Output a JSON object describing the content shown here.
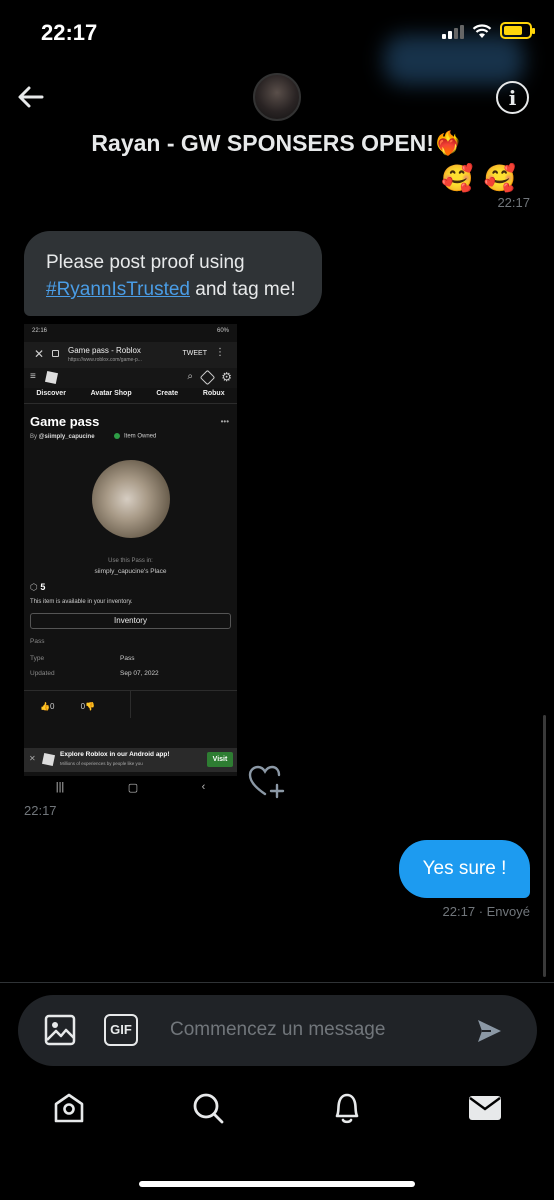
{
  "status_bar": {
    "time": "22:17"
  },
  "header": {
    "title": "Rayan - GW SPONSERS OPEN!❤️‍🔥",
    "back_icon": "arrow-left-icon",
    "info_icon": "info-icon",
    "info_glyph": "i"
  },
  "messages": {
    "emoji_line": "🥰🥰",
    "top_time": "22:17",
    "received": {
      "text_before": "Please post proof using",
      "hashtag": "#RyannIsTrusted",
      "text_after": " and tag me!"
    },
    "image": {
      "status": "22:16",
      "battery": "60%",
      "page_title": "Game pass - Roblox",
      "url": "https://www.roblox.com/game-p...",
      "tweet": "TWEET",
      "nav": [
        "Discover",
        "Avatar Shop",
        "Create",
        "Robux"
      ],
      "heading": "Game pass",
      "by_prefix": "By ",
      "by_user": "@siimply_capucine",
      "owned": "Item Owned",
      "use_pass": "Use this Pass in:",
      "place": "siimply_capucine's Place",
      "price": "5",
      "available": "This item is available in your inventory.",
      "inventory_btn": "Inventory",
      "section": "Pass",
      "type_label": "Type",
      "type_value": "Pass",
      "updated_label": "Updated",
      "updated_value": "Sep 07, 2022",
      "likes": "0",
      "dislikes": "0",
      "ad_title": "Explore Roblox in our Android app!",
      "ad_sub": "Millions of experiences by people like you",
      "ad_btn": "Visit"
    },
    "image_time": "22:17",
    "sent": {
      "text": "Yes sure !",
      "meta": "22:17 · Envoyé"
    }
  },
  "composer": {
    "placeholder": "Commencez un message",
    "gif_label": "GIF",
    "media_icon": "image-icon",
    "send_icon": "send-icon"
  },
  "bottom_nav": {
    "items": [
      "home-icon",
      "search-icon",
      "notifications-icon",
      "messages-icon"
    ]
  },
  "colors": {
    "accent": "#1d9bf0",
    "link": "#4a9de6",
    "bubble_in": "#2f3336",
    "muted": "#71767b"
  }
}
